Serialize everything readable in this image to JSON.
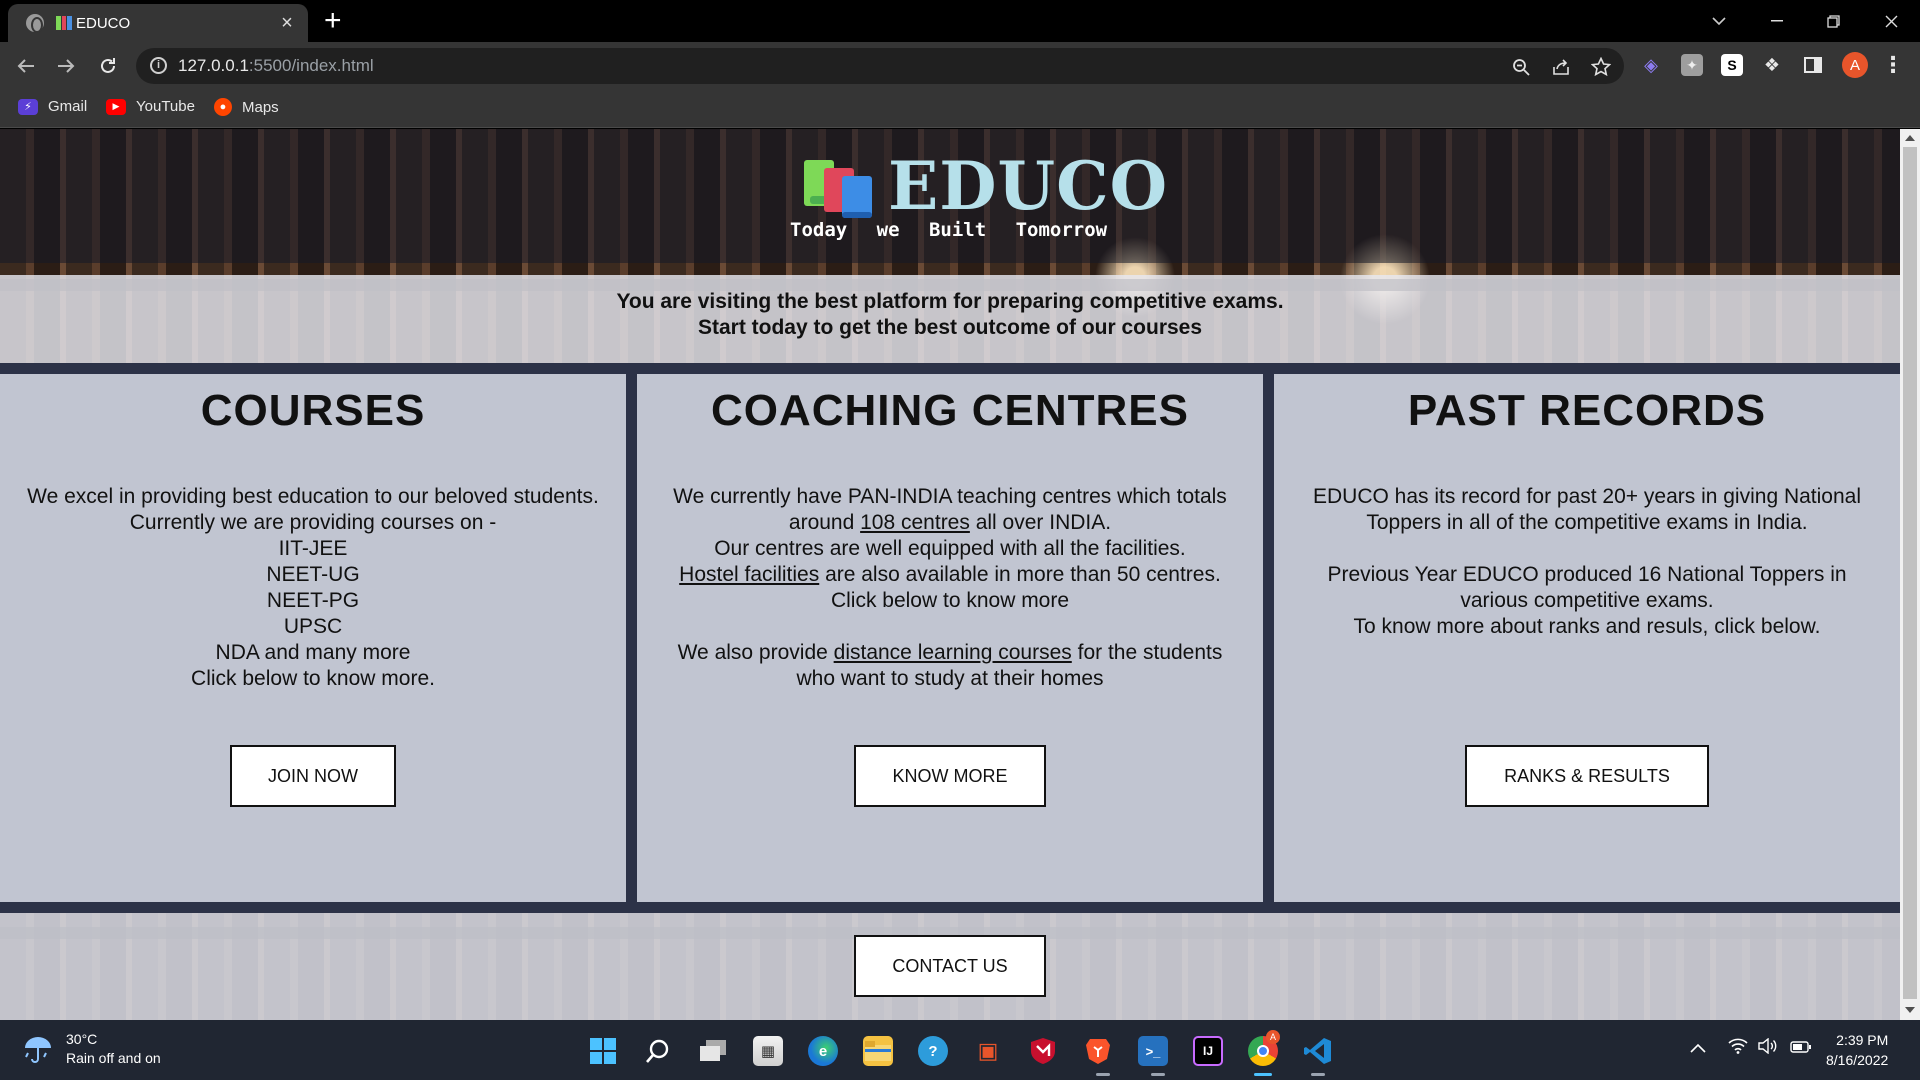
{
  "browser": {
    "tab_title": "EDUCO",
    "tab_close": "×",
    "new_tab": "+",
    "url_host": "127.0.0.1",
    "url_path": ":5500/index.html",
    "bookmarks": [
      {
        "label": "Gmail",
        "icon": "gmail-icon"
      },
      {
        "label": "YouTube",
        "icon": "youtube-icon"
      },
      {
        "label": "Maps",
        "icon": "maps-icon"
      }
    ],
    "profile_initial": "A"
  },
  "site": {
    "brand": "EDUCO",
    "tagline": "Today we Built Tomorrow",
    "intro_line1": "You are visiting the best platform for preparing competitive exams.",
    "intro_line2": "Start today to get the best outcome of our courses",
    "courses": {
      "heading": "COURSES",
      "lines": [
        "We excel in providing best education to our beloved students.",
        "Currently we are providing courses on -",
        "IIT-JEE",
        "NEET-UG",
        "NEET-PG",
        "UPSC",
        "NDA and many more",
        "Click below to know more."
      ],
      "button": "JOIN NOW"
    },
    "centres": {
      "heading": "COACHING CENTRES",
      "line1": "We currently have PAN-INDIA teaching centres which totals",
      "line2_pre": "around ",
      "line2_link": "108 centres",
      "line2_post": " all over INDIA.",
      "line3": "Our centres are well equipped with all the facilities.",
      "line4_link": "Hostel facilities",
      "line4_post": " are also available in more than 50 centres.",
      "line5": "Click below to know more",
      "line6_pre": "We also provide ",
      "line6_link": "distance learning courses",
      "line6_post": " for the students",
      "line7": "who want to study at their homes",
      "button": "KNOW MORE"
    },
    "records": {
      "heading": "PAST RECORDS",
      "line1": "EDUCO has its record for past 20+ years in giving National",
      "line2": "Toppers in all of the competitive exams in India.",
      "line3": "Previous Year EDUCO produced 16 National Toppers in",
      "line4": "various competitive exams.",
      "line5": "To know more about ranks and resuls, click below.",
      "button": "RANKS & RESULTS"
    },
    "contact_button": "CONTACT US"
  },
  "taskbar": {
    "temperature": "30°C",
    "weather": "Rain off and on",
    "time": "2:39 PM",
    "date": "8/16/2022",
    "chrome_badge": "A"
  }
}
